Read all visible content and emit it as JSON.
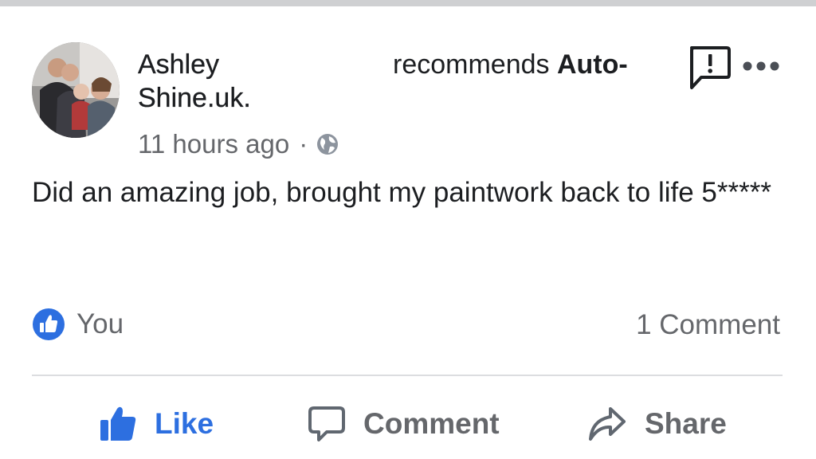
{
  "post": {
    "author": "Ashley Shine.uk.",
    "recommends_prefix": "recommends ",
    "recommends_page": "Auto-",
    "timestamp": "11 hours ago",
    "separator": "·",
    "text": "Did an amazing job, brought my paintwork back to life 5*****"
  },
  "reactions": {
    "liked_by": "You",
    "comment_count": "1 Comment"
  },
  "actions": {
    "like": "Like",
    "comment": "Comment",
    "share": "Share"
  },
  "icons": {
    "privacy": "globe-icon",
    "report": "report-icon",
    "more": "more-icon",
    "reaction": "like-badge-icon"
  },
  "colors": {
    "like_blue": "#2d6fe0",
    "secondary_text": "#65676b",
    "primary_text": "#1c1e21"
  }
}
